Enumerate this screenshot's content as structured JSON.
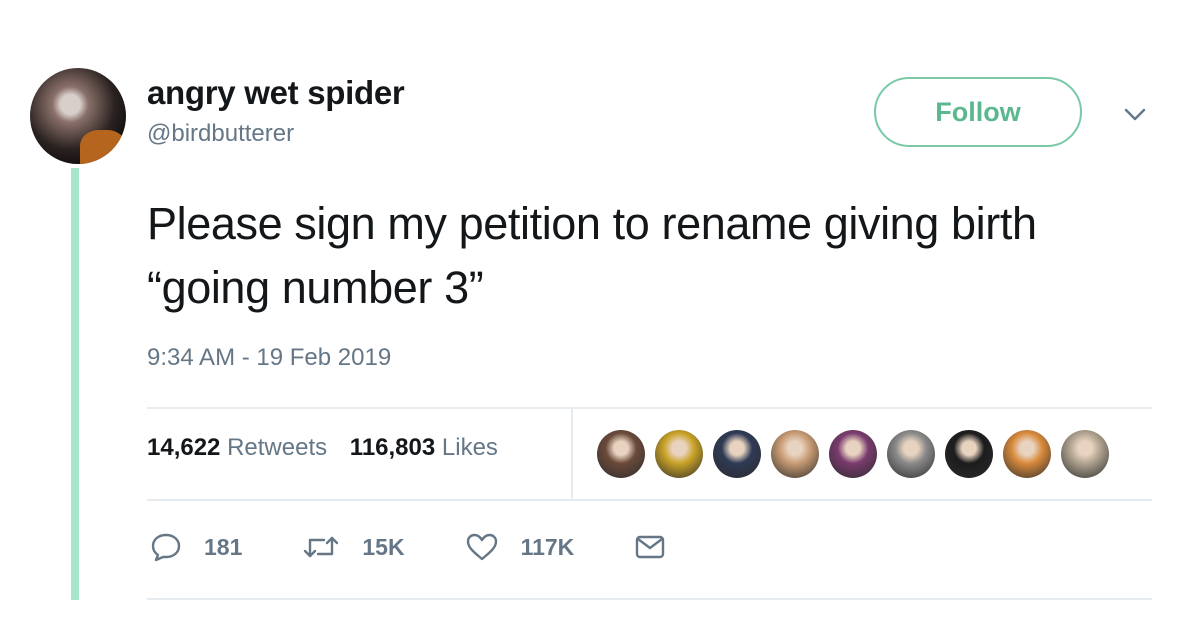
{
  "tweet": {
    "display_name": "angry wet spider",
    "handle": "@birdbutterer",
    "follow_label": "Follow",
    "text": "Please sign my petition to rename giving birth “going number 3”",
    "timestamp": "9:34 AM - 19 Feb 2019"
  },
  "stats": {
    "retweets_count": "14,622",
    "retweets_label": "Retweets",
    "likes_count": "116,803",
    "likes_label": "Likes"
  },
  "likers": [
    "#6b4a3a",
    "#c9a227",
    "#2e3a55",
    "#c89b74",
    "#7a3b6e",
    "#8a8a8a",
    "#1c1c1c",
    "#d98a3c",
    "#b0a38f"
  ],
  "actions": {
    "reply_count": "181",
    "retweet_count": "15K",
    "like_count": "117K"
  },
  "colors": {
    "accent": "#79c9a7",
    "thread_line": "#a3e6cb",
    "secondary_text": "#657786",
    "primary_text": "#14171a",
    "divider": "#e6ecf0"
  },
  "icons": [
    "chevron-down-icon",
    "reply-icon",
    "retweet-icon",
    "heart-icon",
    "mail-icon"
  ]
}
